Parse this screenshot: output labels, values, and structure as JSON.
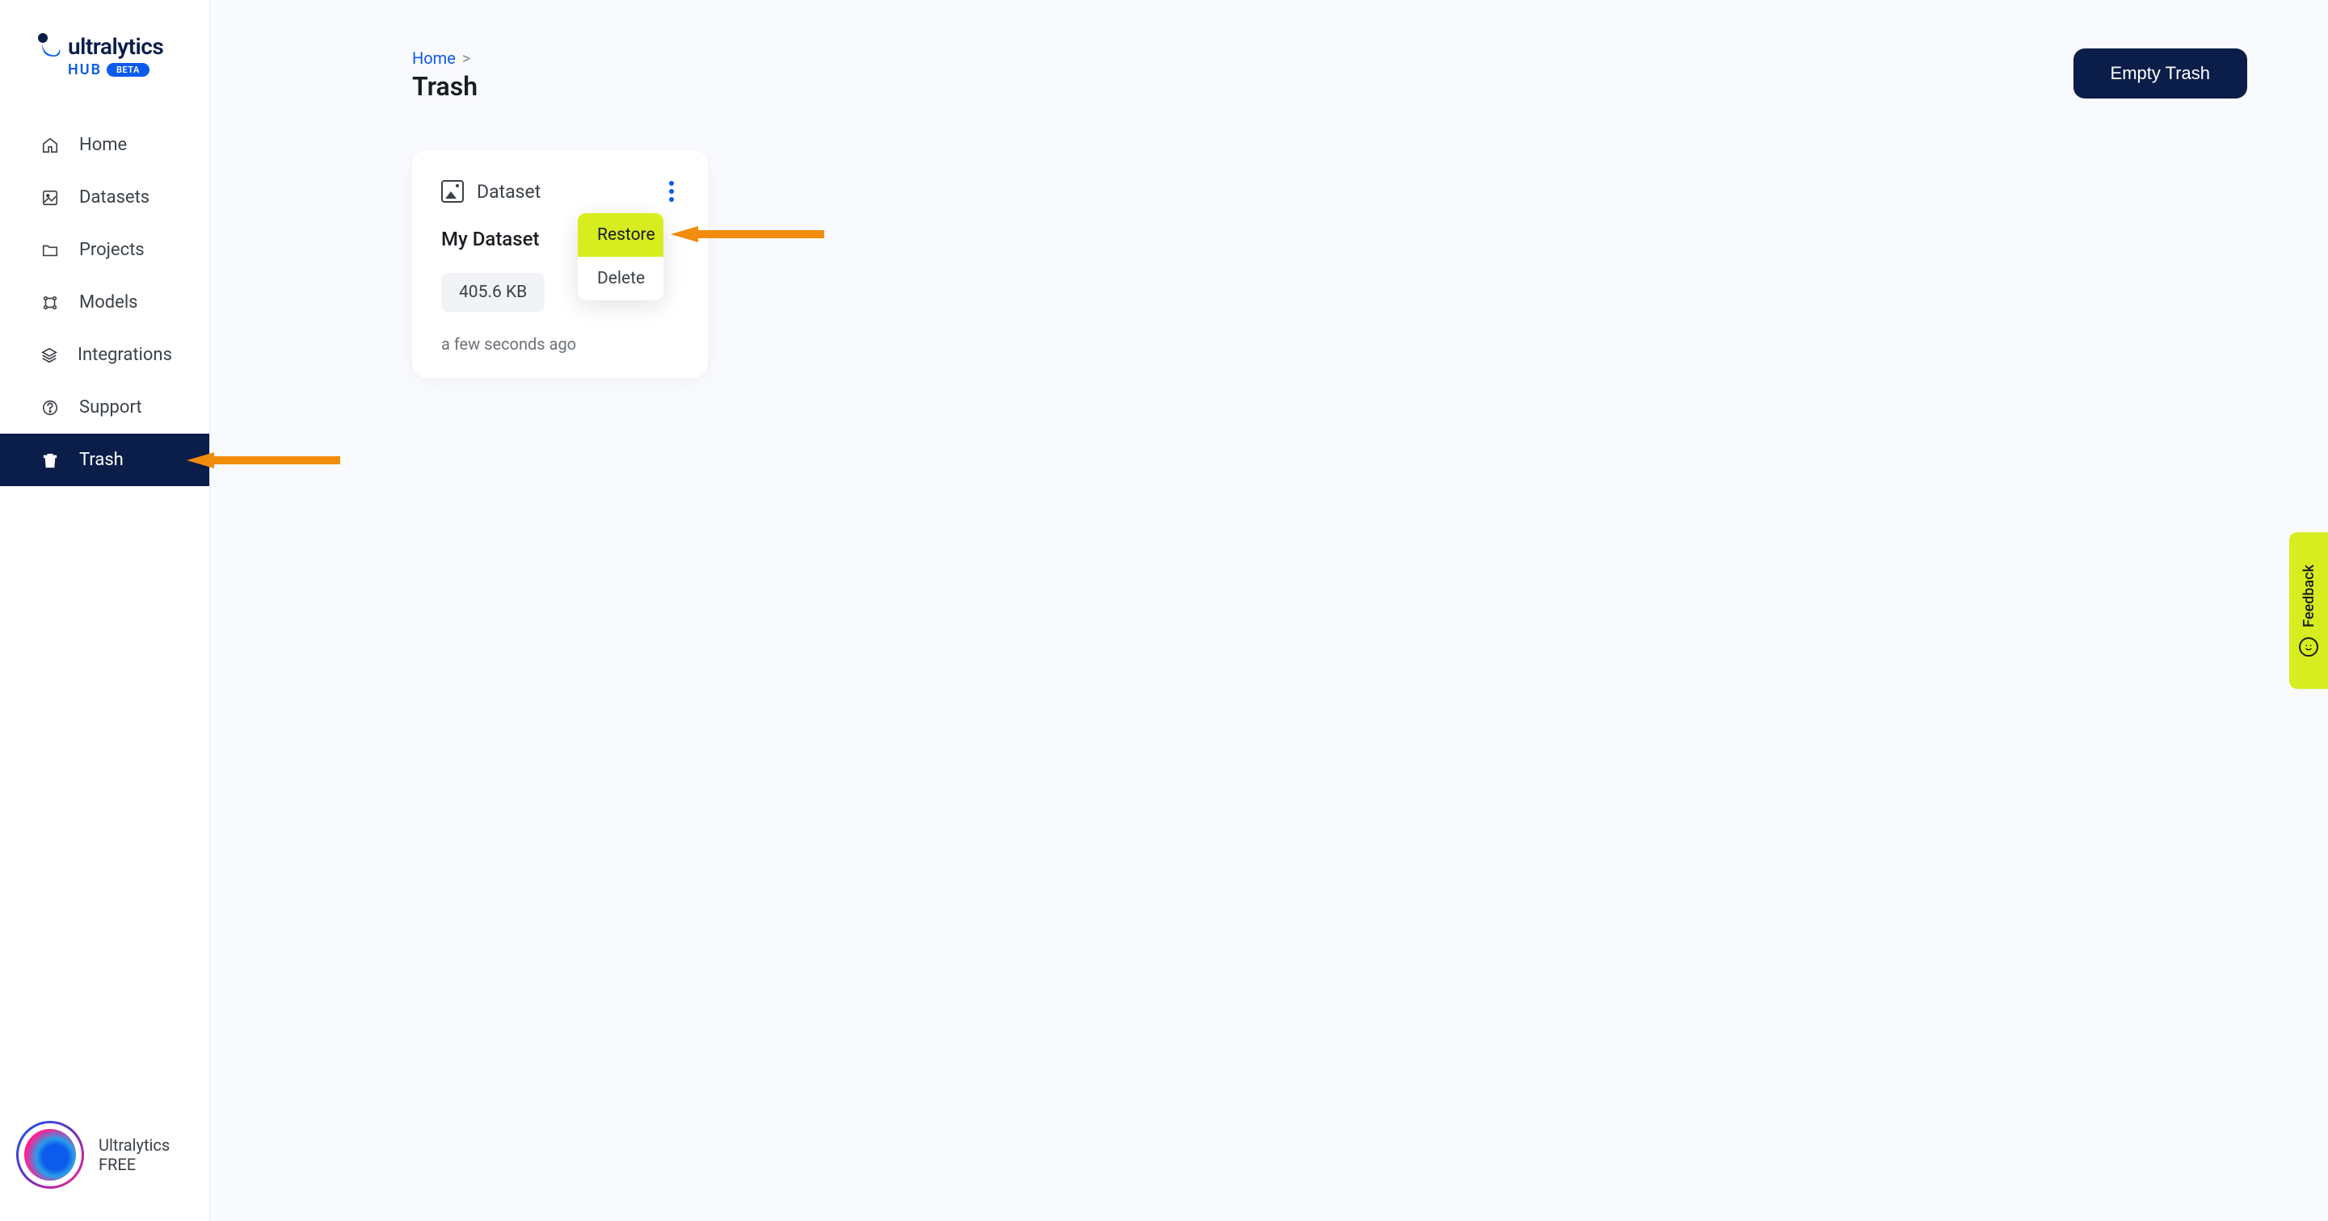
{
  "logo": {
    "brand": "ultralytics",
    "sub": "HUB",
    "badge": "BETA"
  },
  "sidebar": {
    "items": [
      {
        "label": "Home",
        "icon": "home-icon",
        "active": false
      },
      {
        "label": "Datasets",
        "icon": "datasets-icon",
        "active": false
      },
      {
        "label": "Projects",
        "icon": "projects-icon",
        "active": false
      },
      {
        "label": "Models",
        "icon": "models-icon",
        "active": false
      },
      {
        "label": "Integrations",
        "icon": "integrations-icon",
        "active": false
      },
      {
        "label": "Support",
        "icon": "support-icon",
        "active": false
      },
      {
        "label": "Trash",
        "icon": "trash-icon",
        "active": true
      }
    ]
  },
  "user": {
    "name": "Ultralytics",
    "plan": "FREE"
  },
  "breadcrumb": {
    "home": "Home",
    "separator": ">"
  },
  "page": {
    "title": "Trash"
  },
  "actions": {
    "empty_trash": "Empty Trash"
  },
  "card": {
    "type_label": "Dataset",
    "title": "My Dataset",
    "size": "405.6 KB",
    "time": "a few seconds ago"
  },
  "context_menu": {
    "restore": "Restore",
    "delete": "Delete"
  },
  "feedback": {
    "label": "Feedback"
  },
  "colors": {
    "navy": "#0b1e49",
    "blue": "#0d5bed",
    "lime": "#d7ed1f",
    "orange": "#f28c0c"
  }
}
